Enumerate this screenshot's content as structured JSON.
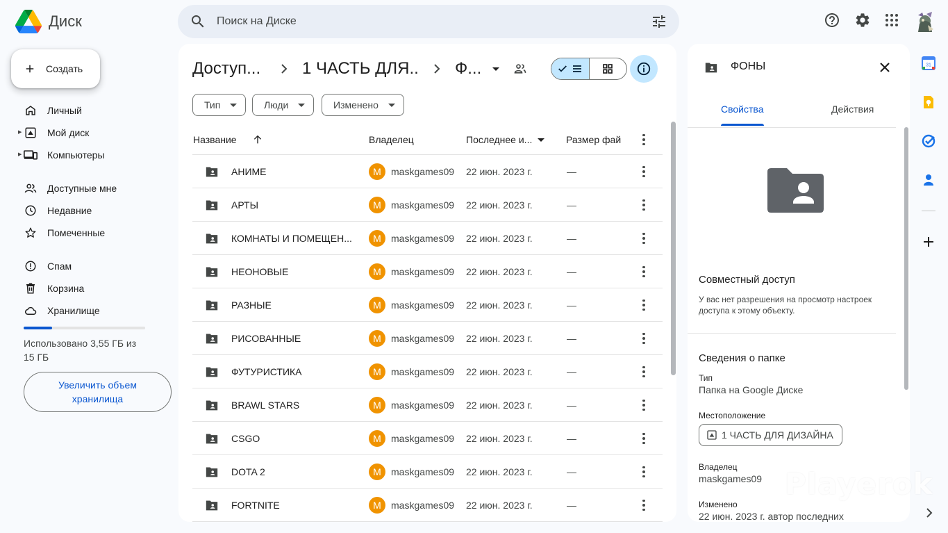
{
  "app": {
    "title": "Диск"
  },
  "search": {
    "placeholder": "Поиск на Диске"
  },
  "sidebar": {
    "create_label": "Создать",
    "items": [
      {
        "label": "Личный",
        "icon": "home-icon"
      },
      {
        "label": "Мой диск",
        "icon": "drive-icon"
      },
      {
        "label": "Компьютеры",
        "icon": "computers-icon"
      },
      {
        "label": "Доступные мне",
        "icon": "shared-icon"
      },
      {
        "label": "Недавние",
        "icon": "clock-icon"
      },
      {
        "label": "Помеченные",
        "icon": "star-icon"
      },
      {
        "label": "Спам",
        "icon": "spam-icon"
      },
      {
        "label": "Корзина",
        "icon": "trash-icon"
      },
      {
        "label": "Хранилище",
        "icon": "cloud-icon"
      }
    ],
    "storage_used_fraction": 0.237,
    "storage_text": "Использовано 3,55 ГБ из 15 ГБ",
    "upgrade_label": "Увеличить объем хранилища"
  },
  "main": {
    "breadcrumbs": [
      "Доступ...",
      "1 ЧАСТЬ ДЛЯ...",
      "Ф..."
    ],
    "breadcrumb_sep": "›",
    "filters": [
      "Тип",
      "Люди",
      "Изменено"
    ],
    "columns": {
      "name": "Название",
      "owner": "Владелец",
      "modified": "Последнее и...",
      "size": "Размер фай"
    },
    "rows": [
      {
        "name": "АНИМЕ",
        "owner": "maskgames09",
        "owner_initial": "M",
        "date": "22 июн. 2023 г.",
        "size": "—"
      },
      {
        "name": "АРТЫ",
        "owner": "maskgames09",
        "owner_initial": "M",
        "date": "22 июн. 2023 г.",
        "size": "—"
      },
      {
        "name": "КОМНАТЫ И ПОМЕЩЕН...",
        "owner": "maskgames09",
        "owner_initial": "M",
        "date": "22 июн. 2023 г.",
        "size": "—"
      },
      {
        "name": "НЕОНОВЫЕ",
        "owner": "maskgames09",
        "owner_initial": "M",
        "date": "22 июн. 2023 г.",
        "size": "—"
      },
      {
        "name": "РАЗНЫЕ",
        "owner": "maskgames09",
        "owner_initial": "M",
        "date": "22 июн. 2023 г.",
        "size": "—"
      },
      {
        "name": "РИСОВАННЫЕ",
        "owner": "maskgames09",
        "owner_initial": "M",
        "date": "22 июн. 2023 г.",
        "size": "—"
      },
      {
        "name": "ФУТУРИСТИКА",
        "owner": "maskgames09",
        "owner_initial": "M",
        "date": "22 июн. 2023 г.",
        "size": "—"
      },
      {
        "name": "BRAWL STARS",
        "owner": "maskgames09",
        "owner_initial": "M",
        "date": "22 июн. 2023 г.",
        "size": "—"
      },
      {
        "name": "CSGO",
        "owner": "maskgames09",
        "owner_initial": "M",
        "date": "22 июн. 2023 г.",
        "size": "—"
      },
      {
        "name": "DOTA 2",
        "owner": "maskgames09",
        "owner_initial": "M",
        "date": "22 июн. 2023 г.",
        "size": "—"
      },
      {
        "name": "FORTNITE",
        "owner": "maskgames09",
        "owner_initial": "M",
        "date": "22 июн. 2023 г.",
        "size": "—"
      }
    ]
  },
  "details": {
    "title": "ФОНЫ",
    "tabs": [
      "Свойства",
      "Действия"
    ],
    "sharing_heading": "Совместный доступ",
    "sharing_text": "У вас нет разрешения на просмотр настроек доступа к этому объекту.",
    "folder_info_heading": "Сведения о папке",
    "type_label": "Тип",
    "type_value": "Папка на Google Диске",
    "location_label": "Местоположение",
    "location_value": "1 ЧАСТЬ ДЛЯ ДИЗАЙНА",
    "owner_label": "Владелец",
    "owner_value": "maskgames09",
    "modified_label": "Изменено",
    "modified_value": "22 июн. 2023 г. автор последних"
  },
  "watermark": "Playerok",
  "colors": {
    "accent": "#0b57d0",
    "selected": "#c2e7ff",
    "owner_avatar": "#f09300",
    "folder": "#5f6368"
  }
}
